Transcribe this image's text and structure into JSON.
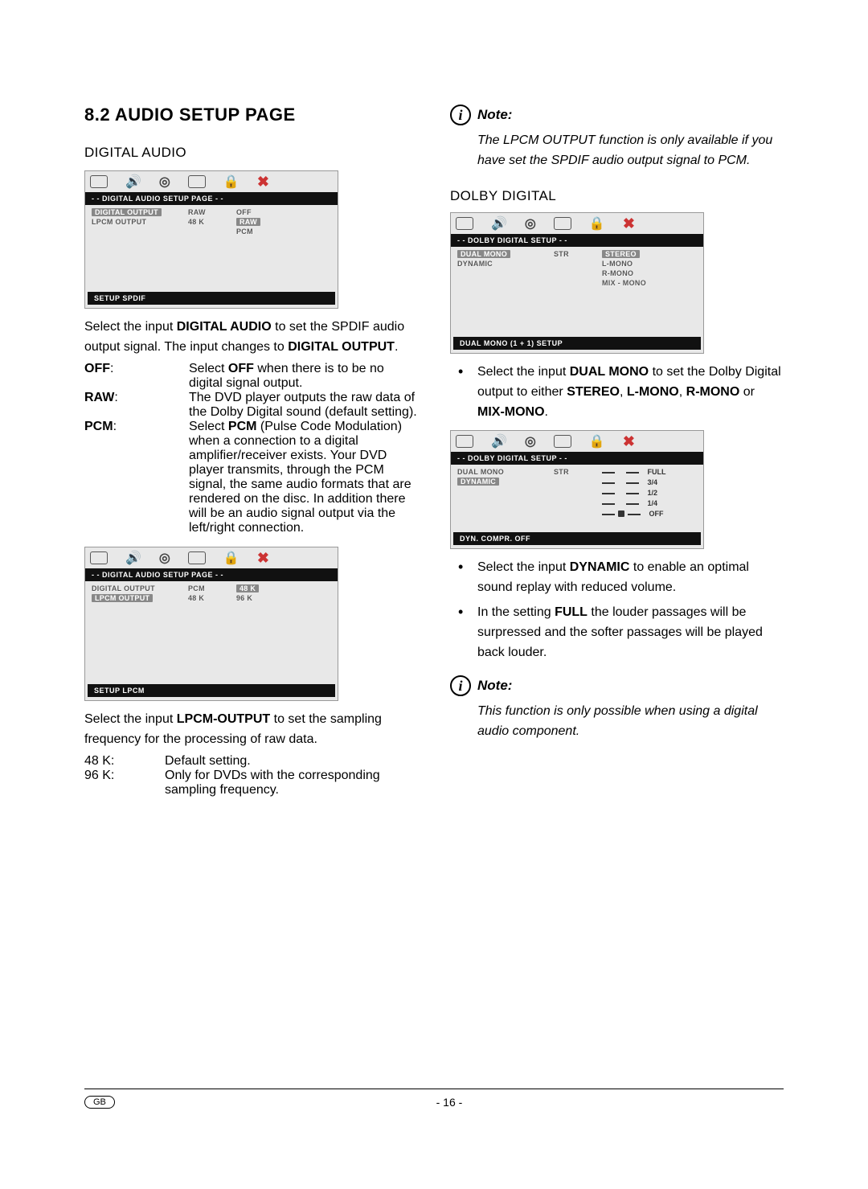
{
  "heading": "8.2 AUDIO SETUP PAGE",
  "sub1": "DIGITAL AUDIO",
  "sub2": "DOLBY DIGITAL",
  "osd1": {
    "title": "- - DIGITAL AUDIO SETUP PAGE - -",
    "r1a": "DIGITAL OUTPUT",
    "r1b": "RAW",
    "r2a": "LPCM OUTPUT",
    "r2b": "48 K",
    "opt1": "OFF",
    "opt2": "RAW",
    "opt3": "PCM",
    "footer": "SETUP SPDIF"
  },
  "p1a": "Select the input ",
  "p1b": "DIGITAL AUDIO",
  "p1c": " to set the SPDIF audio output signal. The input changes to ",
  "p1d": "DIGITAL OUTPUT",
  "p1e": ".",
  "d1": {
    "t": "OFF",
    "a": "Select ",
    "b": "OFF",
    "c": "  when there is to be no digital signal output."
  },
  "d2": {
    "t": "RAW",
    "a": "The DVD player outputs the raw data of the Dolby Digital sound (default setting)."
  },
  "d3": {
    "t": "PCM",
    "a": "Select ",
    "b": "PCM",
    "c": " (Pulse Code Modu­lation) when a connection to a digital amplifier/receiver exists. Your DVD player transmits, through the PCM signal, the same audio formats that are rendered on the disc. In addition there will be an audio signal out­put via the left/right connection."
  },
  "osd2": {
    "title": "- - DIGITAL AUDIO SETUP PAGE - -",
    "r1a": "DIGITAL OUTPUT",
    "r1b": "PCM",
    "r2a": "LPCM OUTPUT",
    "r2b": "48 K",
    "opt1": "48 K",
    "opt2": "96 K",
    "footer": "SETUP LPCM"
  },
  "p2a": "Select the input ",
  "p2b": "LPCM-OUTPUT",
  "p2c": " to set the sampling frequency for the processing of raw data.",
  "d4": {
    "t": "48 K:",
    "a": "Default setting."
  },
  "d5": {
    "t": "96 K:",
    "a": "Only for DVDs with the corres­ponding sampling frequency."
  },
  "note1": {
    "label": "Note:",
    "body": "The LPCM OUTPUT function is only available if you have set the SPDIF audio output signal to PCM."
  },
  "osd3": {
    "title": "- - DOLBY  DIGITAL  SETUP - -",
    "r1a": "DUAL MONO",
    "r1b": "STR",
    "r2a": "DYNAMIC",
    "opt1": "STEREO",
    "opt2": "L-MONO",
    "opt3": "R-MONO",
    "opt4": "MIX - MONO",
    "footer": "DUAL MONO (1 + 1) SETUP"
  },
  "b1a": "Select the input ",
  "b1b": "DUAL MONO",
  "b1c": " to set the Dolby Digital output to either ",
  "b1d": "STEREO",
  "b1e": ", ",
  "b1f": "L-MONO",
  "b1g": ", ",
  "b1h": "R-MONO",
  "b1i": " or ",
  "b1j": "MIX-MONO",
  "b1k": ".",
  "osd4": {
    "title": "- - DOLBY  DIGITAL  SETUP - -",
    "r1a": "DUAL MONO",
    "r1b": "STR",
    "r2a": "DYNAMIC",
    "v1": "FULL",
    "v2": "3/4",
    "v3": "1/2",
    "v4": "1/4",
    "v5": "OFF",
    "footer": "DYN. COMPR. OFF"
  },
  "b2a": "Select the input ",
  "b2b": "DYNAMIC",
  "b2c": " to enable an optimal sound replay with reduced volume.",
  "b3a": "In the setting ",
  "b3b": "FULL",
  "b3c": " the louder passages will be surpressed and the softer passages will be played back louder.",
  "note2": {
    "label": "Note:",
    "body": "This function is only possible when using a digital audio component."
  },
  "footer": {
    "gb": "GB",
    "page": "- 16 -"
  }
}
